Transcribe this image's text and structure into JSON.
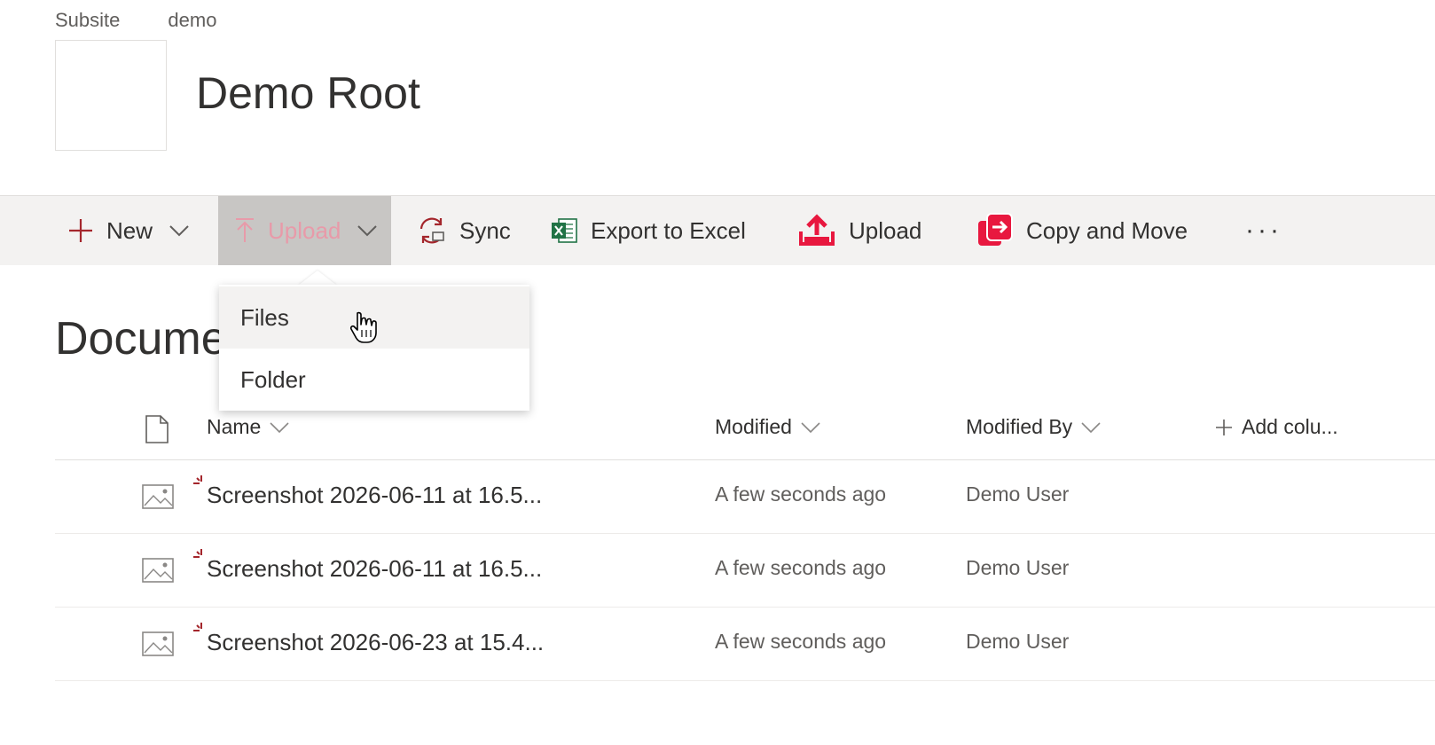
{
  "breadcrumb": [
    "Subsite",
    "demo"
  ],
  "site": {
    "title": "Demo Root"
  },
  "commandbar": {
    "new_label": "New",
    "upload_label": "Upload",
    "sync_label": "Sync",
    "export_label": "Export to Excel",
    "upload2_label": "Upload",
    "copy_move_label": "Copy and Move",
    "more_label": "···",
    "icons": {
      "new": "plus-icon",
      "upload": "upload-arrow-icon",
      "sync": "sync-icon",
      "export": "excel-icon",
      "upload2": "upload-box-icon",
      "copy_move": "copy-move-icon"
    }
  },
  "upload_menu": {
    "items": [
      {
        "label": "Files",
        "hovered": true
      },
      {
        "label": "Folder"
      }
    ]
  },
  "library": {
    "title": "Documents",
    "columns": {
      "name": "Name",
      "modified": "Modified",
      "modified_by": "Modified By",
      "add_column": "Add colu..."
    },
    "rows": [
      {
        "name": "Screenshot 2026-06-11 at 16.5...",
        "modified": "A few seconds ago",
        "modified_by": "Demo User"
      },
      {
        "name": "Screenshot 2026-06-11 at 16.5...",
        "modified": "A few seconds ago",
        "modified_by": "Demo User"
      },
      {
        "name": "Screenshot 2026-06-23 at 15.4...",
        "modified": "A few seconds ago",
        "modified_by": "Demo User"
      }
    ]
  },
  "colors": {
    "accent": "#a4262c",
    "command_bar_bg": "#f3f2f1",
    "active_button_bg": "#c8c6c4",
    "brand_red": "#e8183f",
    "excel_green": "#217346"
  }
}
